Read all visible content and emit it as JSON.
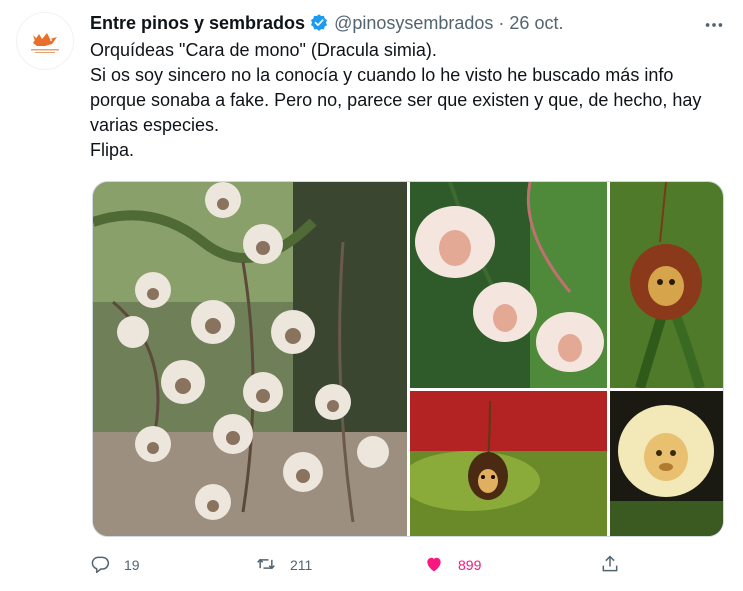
{
  "tweet": {
    "author_name": "Entre pinos y sembrados",
    "handle": "@pinosysembrados",
    "separator": "·",
    "date": "26 oct.",
    "text_lines": [
      "Orquídeas \"Cara de mono\" (Dracula simia).",
      "Si os soy sincero no la conocía y cuando lo he visto he buscado más info porque sonaba a fake. Pero no, parece ser que existen y que, de hecho, hay varias especies.",
      "Flipa."
    ]
  },
  "actions": {
    "reply_count": "19",
    "retweet_count": "211",
    "like_count": "899"
  },
  "icons": {
    "verified": "verified-badge-icon",
    "more": "more-icon",
    "reply": "reply-icon",
    "retweet": "retweet-icon",
    "like": "heart-icon",
    "share": "share-icon"
  },
  "colors": {
    "accent_blue": "#1d9bf0",
    "like_pink": "#f91880",
    "secondary_text": "#536471",
    "avatar_logo": "#e8702a"
  }
}
